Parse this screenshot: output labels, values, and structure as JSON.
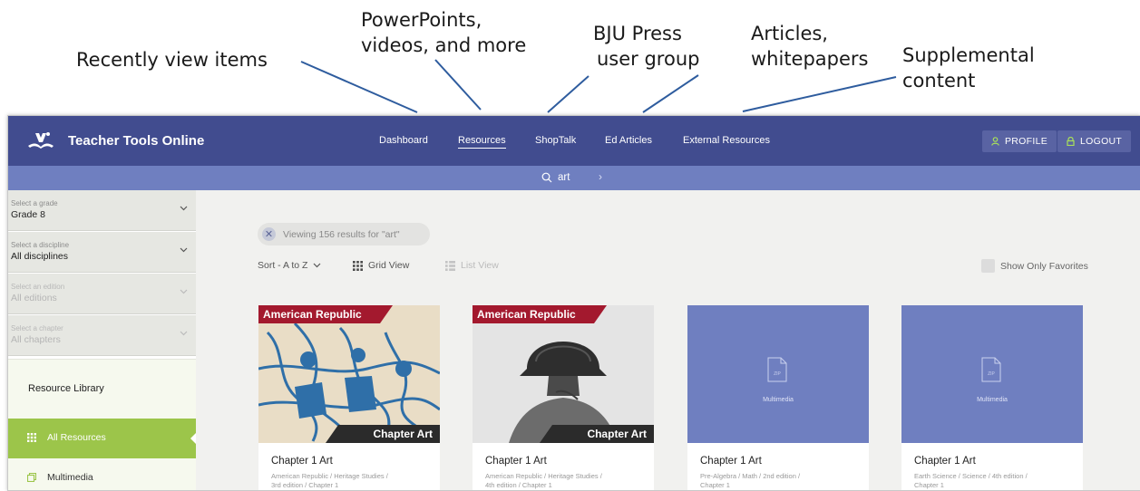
{
  "annotations": {
    "recent": "Recently view items",
    "resources_1": "PowerPoints,",
    "resources_2": "videos, and more",
    "shoptalk_1": "BJU Press",
    "shoptalk_2": "user group",
    "articles_1": "Articles,",
    "articles_2": "whitepapers",
    "external_1": "Supplemental",
    "external_2": "content"
  },
  "app": {
    "title": "Teacher Tools Online",
    "nav": [
      "Dashboard",
      "Resources",
      "ShopTalk",
      "Ed Articles",
      "External Resources"
    ],
    "active_nav": "Resources",
    "profile_label": "PROFILE",
    "logout_label": "LOGOUT"
  },
  "search": {
    "query": "art"
  },
  "sidebar": {
    "selects": [
      {
        "label": "Select a grade",
        "value": "Grade 8",
        "enabled": true
      },
      {
        "label": "Select a discipline",
        "value": "All disciplines",
        "enabled": true
      },
      {
        "label": "Select an edition",
        "value": "All editions",
        "enabled": false
      },
      {
        "label": "Select a chapter",
        "value": "All chapters",
        "enabled": false
      }
    ],
    "library_title": "Resource Library",
    "items": [
      {
        "label": "All Resources",
        "icon": "grid-icon",
        "active": true
      },
      {
        "label": "Multimedia",
        "icon": "multimedia-icon",
        "active": false
      }
    ]
  },
  "results": {
    "chip_text": "Viewing 156 results for \"art\"",
    "sort_label": "Sort - A to Z",
    "grid_view_label": "Grid View",
    "list_view_label": "List View",
    "favorites_label": "Show Only Favorites"
  },
  "cards": [
    {
      "type": "image",
      "banner": "American Republic",
      "tag": "Chapter Art",
      "title": "Chapter 1 Art",
      "path": "American Republic / Heritage Studies /",
      "path2": "3rd edition / Chapter 1"
    },
    {
      "type": "image",
      "banner": "American Republic",
      "tag": "Chapter Art",
      "title": "Chapter 1 Art",
      "path": "American Republic / Heritage Studies /",
      "path2": "4th edition / Chapter 1"
    },
    {
      "type": "multimedia",
      "file_label": "ZIP",
      "caption": "Multimedia",
      "title": "Chapter 1 Art",
      "path": "Pre-Algebra / Math / 2nd edition /",
      "path2": "Chapter 1"
    },
    {
      "type": "multimedia",
      "file_label": "ZIP",
      "caption": "Multimedia",
      "title": "Chapter 1 Art",
      "path": "Earth Science / Science / 4th edition /",
      "path2": "Chapter 1"
    }
  ],
  "colors": {
    "topbar": "#414c8f",
    "searchbar": "#6f7fc0",
    "accent_green": "#9cc54a",
    "banner_red": "#a3192e",
    "tag_dark": "#2b2b2b"
  }
}
